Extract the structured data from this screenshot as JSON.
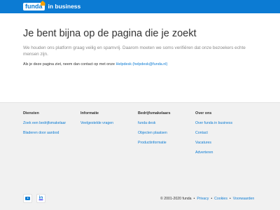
{
  "header": {
    "logo_text": "funda",
    "logo_subtitle": "in business"
  },
  "main": {
    "title": "Je bent bijna op de pagina die je zoekt",
    "lead": "We houden ons platform graag veilig en spamvrij. Daarom moeten we soms verifiëren dat onze bezoekers echte mensen zijn.",
    "note_prefix": "Als je deze pagina ziet, neem dan contact op met onze ",
    "note_link": "Helpdesk (helpdesk@funda.nl)"
  },
  "footer": {
    "columns": [
      {
        "heading": "Diensten",
        "links": [
          "Zoek een bedrijfsmakelaar",
          "Bladeren door aanbod"
        ]
      },
      {
        "heading": "Informatie",
        "links": [
          "Veelgestelde vragen"
        ]
      },
      {
        "heading": "Bedrijfsmakelaars",
        "links": [
          "funda desk",
          "Objecten plaatsen",
          "Productinformatie"
        ]
      },
      {
        "heading": "Over ons",
        "links": [
          "Over funda in business",
          "Contact",
          "Vacatures",
          "Adverteren"
        ]
      }
    ],
    "social": {
      "youtube_icon": "youtube-icon",
      "linkedin_label": "in"
    },
    "copyright": "© 2001-2020 funda",
    "legal_links": [
      "Privacy",
      "Cookies",
      "Voorwaarden"
    ],
    "separator": "•"
  },
  "colors": {
    "brand_blue": "#0c7bd3",
    "accent_orange": "#f7a100",
    "footer_bg": "#f1f1f1"
  }
}
